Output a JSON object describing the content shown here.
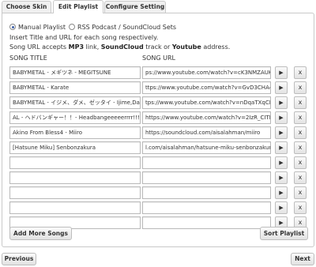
{
  "tabs": [
    {
      "label": "Choose Skin"
    },
    {
      "label": "Edit Playlist"
    },
    {
      "label": "Configure Setting"
    }
  ],
  "playlist_type": {
    "options": [
      "Manual Playlist",
      "RSS Podcast / SoundCloud Sets"
    ],
    "selected": "Manual Playlist"
  },
  "help": {
    "line1": "Insert Title and URL for each song respectively.",
    "line2_a": "Song URL accepts ",
    "line2_b": "MP3",
    "line2_c": " link, ",
    "line2_d": "SoundCloud",
    "line2_e": " track or ",
    "line2_f": "Youtube",
    "line2_g": " address."
  },
  "columns": {
    "title": "SONG TITLE",
    "url": "SONG URL"
  },
  "songs": [
    {
      "title": "BABYMETAL - メギツネ - MEGITSUNE",
      "url": "ps://www.youtube.com/watch?v=cK3NMZAUKGw"
    },
    {
      "title": "BABYMETAL - Karate",
      "url": "ttps://www.youtube.com/watch?v=GvD3CHA48pA"
    },
    {
      "title": "BABYMETAL - イジメ、ダメ、ゼッタイ - Ijime,Dame,",
      "url": "tps://www.youtube.com/watch?v=nDqaTXqCN-0"
    },
    {
      "title": "AL - ヘドバンギャー！！- Headbangeeeeerrrr!!!!",
      "url": "https://www.youtube.com/watch?v=2IzR_CITE8Y"
    },
    {
      "title": "Akino From Bless4 - Miiro",
      "url": "https://soundcloud.com/aisalahman/miiro"
    },
    {
      "title": "[Hatsune Miku] Senbonzakura",
      "url": "l.com/aisalahman/hatsune-miku-senbonzakura"
    },
    {
      "title": "",
      "url": ""
    },
    {
      "title": "",
      "url": ""
    },
    {
      "title": "",
      "url": ""
    },
    {
      "title": "",
      "url": ""
    },
    {
      "title": "",
      "url": ""
    }
  ],
  "row_buttons": {
    "play": "▶",
    "delete": "x"
  },
  "buttons": {
    "add_more": "Add More Songs",
    "sort": "Sort Playlist",
    "previous": "Previous",
    "next": "Next"
  }
}
